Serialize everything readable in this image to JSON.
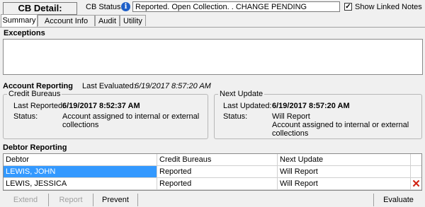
{
  "header": {
    "title": "CB Detail:",
    "status_label": "CB Status:",
    "status_value": "Reported. Open Collection. . CHANGE PENDING",
    "show_linked_notes_label": "Show Linked Notes",
    "show_linked_notes_checked": true
  },
  "tabs": [
    {
      "label": "Summary",
      "active": true
    },
    {
      "label": "Account Info",
      "active": false
    },
    {
      "label": "Audit",
      "active": false
    },
    {
      "label": "Utility",
      "active": false
    }
  ],
  "exceptions": {
    "title": "Exceptions"
  },
  "account_reporting": {
    "title": "Account Reporting",
    "last_evaluated_label": "Last Evaluated:",
    "last_evaluated_value": "6/19/2017 8:57:20 AM",
    "credit_bureaus": {
      "legend": "Credit Bureaus",
      "last_reported_label": "Last Reported:",
      "last_reported_value": "6/19/2017 8:52:37 AM",
      "status_label": "Status:",
      "status_line1": "Account assigned to internal or external",
      "status_line2": "collections"
    },
    "next_update": {
      "legend": "Next Update",
      "last_updated_label": "Last Updated:",
      "last_updated_value": "6/19/2017 8:57:20 AM",
      "status_label": "Status:",
      "status_line1": "Will Report",
      "status_line2": "Account assigned to internal or external",
      "status_line3": "collections"
    }
  },
  "debtor_reporting": {
    "title": "Debtor Reporting",
    "columns": [
      "Debtor",
      "Credit Bureaus",
      "Next Update"
    ],
    "rows": [
      {
        "debtor": "LEWIS, JOHN",
        "credit_bureaus": "Reported",
        "next_update": "Will Report",
        "selected": true
      },
      {
        "debtor": "LEWIS, JESSICA",
        "credit_bureaus": "Reported",
        "next_update": "Will Report",
        "selected": false
      }
    ]
  },
  "buttons": {
    "extend": "Extend",
    "report": "Report",
    "prevent": "Prevent",
    "evaluate": "Evaluate"
  },
  "icons": {
    "info": "info-icon",
    "checkbox": "checkmark-icon",
    "delete": "delete-x-icon"
  },
  "colors": {
    "selection": "#3399ff",
    "info_icon": "#1e5fc8",
    "delete_icon": "#d02010"
  }
}
